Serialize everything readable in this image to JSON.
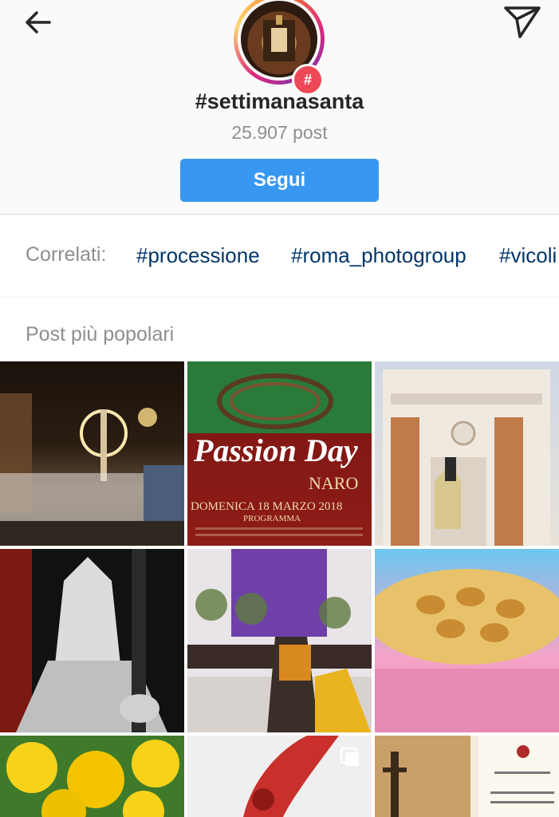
{
  "header": {
    "hashtag": "#settimanasanta",
    "post_count": "25.907 post",
    "follow_label": "Segui",
    "badge": "#"
  },
  "related": {
    "label": "Correlati:",
    "tags": [
      "#processione",
      "#roma_photogroup",
      "#vicoli"
    ]
  },
  "section": {
    "title": "Post più popolari"
  },
  "posts": [
    {
      "name": "procession-night"
    },
    {
      "name": "passion-day-poster"
    },
    {
      "name": "church-facade"
    },
    {
      "name": "hooded-figure"
    },
    {
      "name": "altar-priest"
    },
    {
      "name": "pastries"
    },
    {
      "name": "yellow-flowers"
    },
    {
      "name": "bleeding-hand",
      "multi": true
    },
    {
      "name": "document-photo"
    }
  ],
  "poster_text": {
    "line1": "Passion Day",
    "line2": "NARO",
    "line3": "DOMENICA 18 MARZO 2018",
    "line4": "PROGRAMMA"
  },
  "colors": {
    "follow_bg": "#3897f0",
    "link": "#003569",
    "muted": "#8e8e8e",
    "badge": "#ed4956"
  }
}
